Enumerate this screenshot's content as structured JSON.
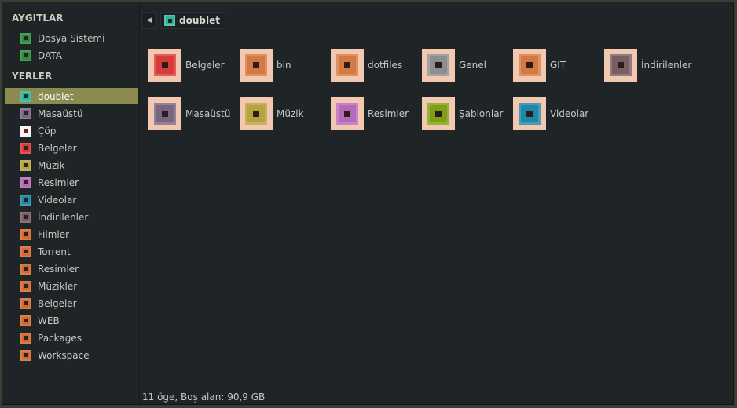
{
  "sidebar": {
    "devices_header": "AYGITLAR",
    "devices": [
      {
        "label": "Dosya Sistemi",
        "icon": "drive-icon",
        "color": "#2e8b3c"
      },
      {
        "label": "DATA",
        "icon": "drive-icon",
        "color": "#2e8b3c"
      }
    ],
    "places_header": "YERLER",
    "places": [
      {
        "label": "doublet",
        "icon": "home-folder-icon",
        "color": "#2bb5a0",
        "selected": true
      },
      {
        "label": "Masaüstü",
        "icon": "folder-icon",
        "color": "#7a6680"
      },
      {
        "label": "Çöp",
        "icon": "trash-icon",
        "color": "#f4f4f4"
      },
      {
        "label": "Belgeler",
        "icon": "folder-icon",
        "color": "#d93a3a"
      },
      {
        "label": "Müzik",
        "icon": "folder-icon",
        "color": "#b5a340"
      },
      {
        "label": "Resimler",
        "icon": "folder-icon",
        "color": "#b76ab8"
      },
      {
        "label": "Videolar",
        "icon": "folder-icon",
        "color": "#1e88a8"
      },
      {
        "label": "İndirilenler",
        "icon": "folder-icon",
        "color": "#7a5e5e"
      },
      {
        "label": "Filmler",
        "icon": "folder-icon",
        "color": "#d46a30"
      },
      {
        "label": "Torrent",
        "icon": "folder-icon",
        "color": "#d46a30"
      },
      {
        "label": "Resimler",
        "icon": "folder-icon",
        "color": "#d46a30"
      },
      {
        "label": "Müzikler",
        "icon": "folder-icon",
        "color": "#d46a30"
      },
      {
        "label": "Belgeler",
        "icon": "folder-icon",
        "color": "#d46a30"
      },
      {
        "label": "WEB",
        "icon": "folder-icon",
        "color": "#d46a30"
      },
      {
        "label": "Packages",
        "icon": "folder-icon",
        "color": "#d46a30"
      },
      {
        "label": "Workspace",
        "icon": "folder-icon",
        "color": "#d46a30"
      }
    ]
  },
  "toolbar": {
    "back_icon": "back-arrow-icon",
    "breadcrumb": "doublet",
    "breadcrumb_color": "#2bb5a0"
  },
  "folders": [
    {
      "label": "Belgeler",
      "color": "#d93a3a"
    },
    {
      "label": "bin",
      "color": "#d47a40"
    },
    {
      "label": "dotfiles",
      "color": "#d47a40"
    },
    {
      "label": "Genel",
      "color": "#8e8e8e"
    },
    {
      "label": "GIT",
      "color": "#d47a40"
    },
    {
      "label": "İndirilenler",
      "color": "#7a5e62"
    },
    {
      "label": "Masaüstü",
      "color": "#7a6680"
    },
    {
      "label": "Müzik",
      "color": "#b5a340"
    },
    {
      "label": "Resimler",
      "color": "#b76ab8"
    },
    {
      "label": "Şablonlar",
      "color": "#7ea014"
    },
    {
      "label": "Videolar",
      "color": "#1e88a8"
    }
  ],
  "status": "11 öge, Boş alan: 90,9 GB"
}
